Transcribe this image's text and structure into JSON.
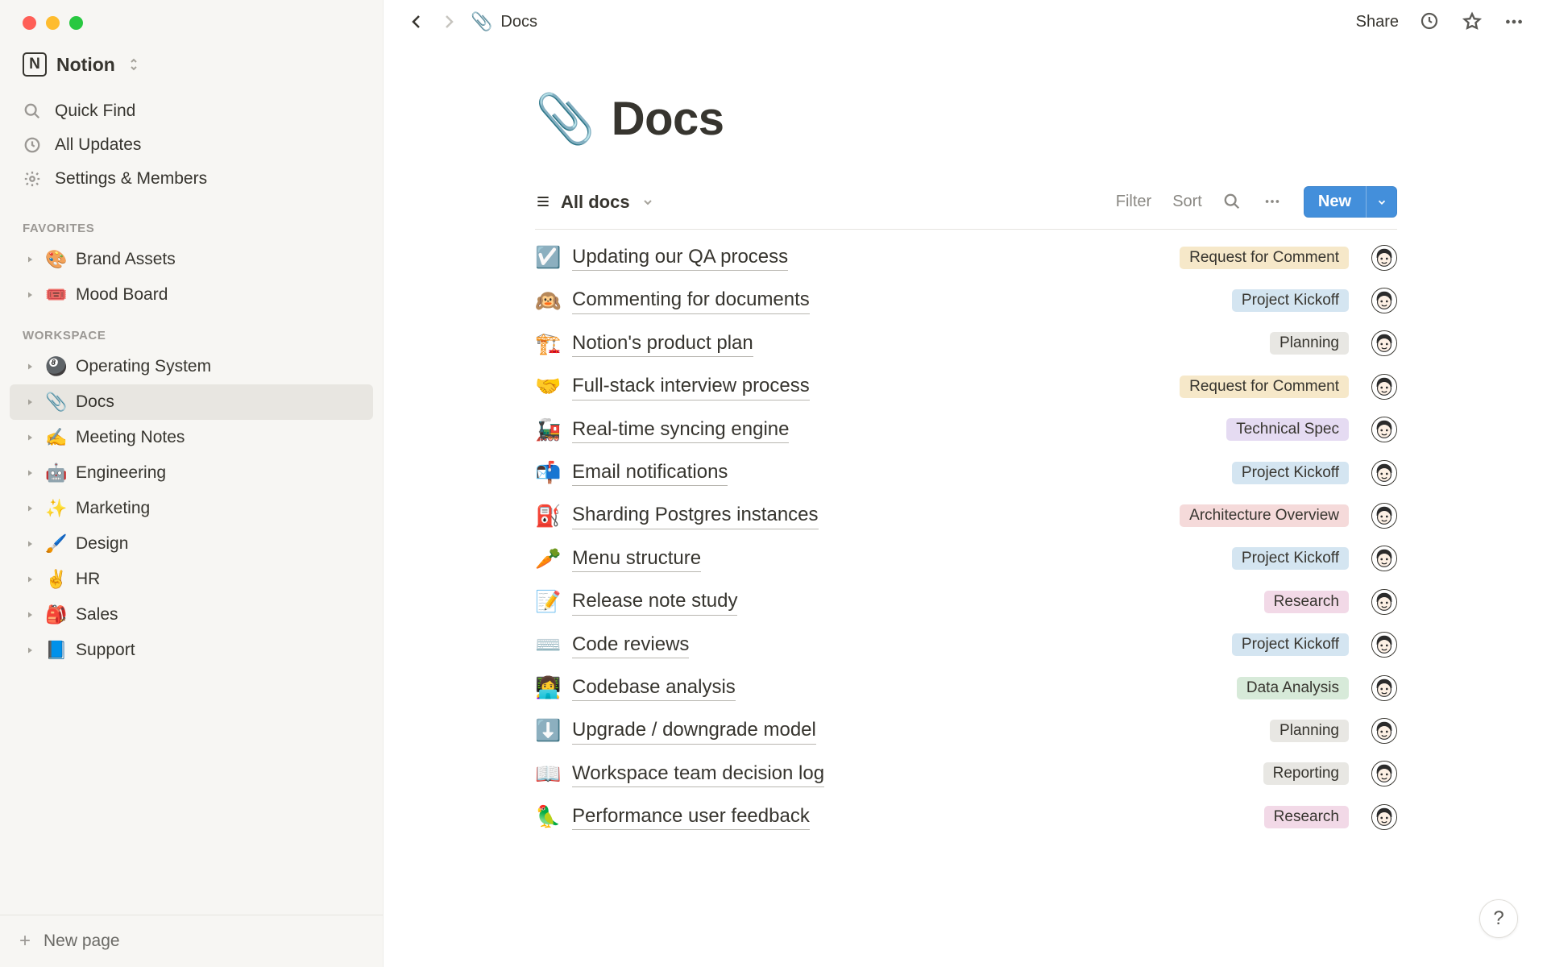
{
  "workspace": {
    "name": "Notion",
    "logo_letter": "N"
  },
  "nav": {
    "quick_find": "Quick Find",
    "all_updates": "All Updates",
    "settings": "Settings & Members"
  },
  "sections": {
    "favorites_header": "FAVORITES",
    "workspace_header": "WORKSPACE"
  },
  "favorites": [
    {
      "emoji": "🎨",
      "label": "Brand Assets"
    },
    {
      "emoji": "🎟️",
      "label": "Mood Board"
    }
  ],
  "workspace_pages": [
    {
      "emoji": "🎱",
      "label": "Operating System",
      "active": false
    },
    {
      "emoji": "📎",
      "label": "Docs",
      "active": true
    },
    {
      "emoji": "✍️",
      "label": "Meeting Notes",
      "active": false
    },
    {
      "emoji": "🤖",
      "label": "Engineering",
      "active": false
    },
    {
      "emoji": "✨",
      "label": "Marketing",
      "active": false
    },
    {
      "emoji": "🖌️",
      "label": "Design",
      "active": false
    },
    {
      "emoji": "✌️",
      "label": "HR",
      "active": false
    },
    {
      "emoji": "🎒",
      "label": "Sales",
      "active": false
    },
    {
      "emoji": "📘",
      "label": "Support",
      "active": false
    }
  ],
  "new_page_label": "New page",
  "topbar": {
    "breadcrumb_icon": "📎",
    "breadcrumb_label": "Docs",
    "share_label": "Share"
  },
  "page": {
    "icon": "📎",
    "title": "Docs"
  },
  "database": {
    "view_name": "All docs",
    "filter_label": "Filter",
    "sort_label": "Sort",
    "new_label": "New"
  },
  "tag_colors": {
    "Request for Comment": "#f6e8c9",
    "Project Kickoff": "#d4e5f1",
    "Planning": "#e8e7e3",
    "Technical Spec": "#e5dbf2",
    "Architecture Overview": "#f5dada",
    "Research": "#f2d9e7",
    "Data Analysis": "#d7ead9",
    "Reporting": "#e8e7e3"
  },
  "docs": [
    {
      "emoji": "☑️",
      "title": "Updating our QA process",
      "tag": "Request for Comment"
    },
    {
      "emoji": "🙉",
      "title": "Commenting for documents",
      "tag": "Project Kickoff"
    },
    {
      "emoji": "🏗️",
      "title": "Notion's product plan",
      "tag": "Planning"
    },
    {
      "emoji": "🤝",
      "title": "Full-stack interview process",
      "tag": "Request for Comment"
    },
    {
      "emoji": "🚂",
      "title": "Real-time syncing engine",
      "tag": "Technical Spec"
    },
    {
      "emoji": "📬",
      "title": "Email notifications",
      "tag": "Project Kickoff"
    },
    {
      "emoji": "⛽",
      "title": "Sharding Postgres instances",
      "tag": "Architecture Overview"
    },
    {
      "emoji": "🥕",
      "title": "Menu structure",
      "tag": "Project Kickoff"
    },
    {
      "emoji": "📝",
      "title": "Release note study",
      "tag": "Research"
    },
    {
      "emoji": "⌨️",
      "title": "Code reviews",
      "tag": "Project Kickoff"
    },
    {
      "emoji": "👩‍💻",
      "title": "Codebase analysis",
      "tag": "Data Analysis"
    },
    {
      "emoji": "⬇️",
      "title": "Upgrade / downgrade model",
      "tag": "Planning"
    },
    {
      "emoji": "📖",
      "title": "Workspace team decision log",
      "tag": "Reporting"
    },
    {
      "emoji": "🦜",
      "title": "Performance user feedback",
      "tag": "Research"
    }
  ],
  "help_label": "?"
}
